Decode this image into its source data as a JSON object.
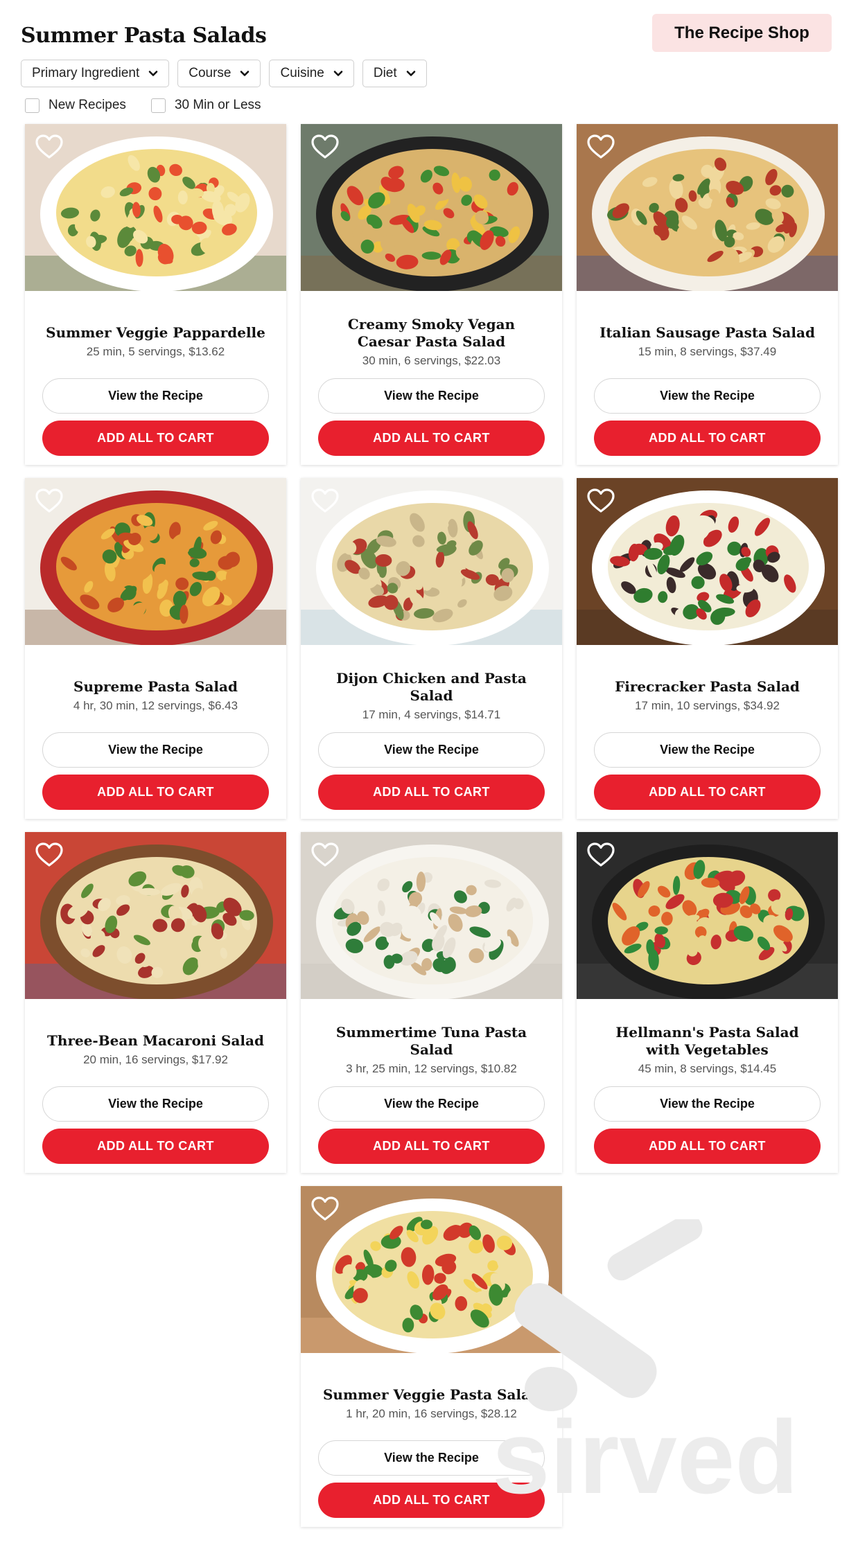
{
  "header": {
    "title": "Summer Pasta Salads",
    "shop_label": "The Recipe Shop"
  },
  "filters": [
    {
      "label": "Primary Ingredient"
    },
    {
      "label": "Course"
    },
    {
      "label": "Cuisine"
    },
    {
      "label": "Diet"
    }
  ],
  "checkboxes": [
    {
      "label": "New Recipes",
      "checked": false
    },
    {
      "label": "30 Min or Less",
      "checked": false
    }
  ],
  "buttons": {
    "view_label": "View the Recipe",
    "cart_label": "ADD ALL TO CART"
  },
  "colors": {
    "accent": "#e8202e",
    "badge_bg": "#fbe3e3"
  },
  "watermark_text": "sirved",
  "recipes": [
    {
      "title": "Summer Veggie Pappardelle",
      "meta": "25 min, 5 servings, $13.62",
      "favorited": false
    },
    {
      "title": "Creamy Smoky Vegan Caesar Pasta Salad",
      "meta": "30 min, 6 servings, $22.03",
      "favorited": false
    },
    {
      "title": "Italian Sausage Pasta Salad",
      "meta": "15 min, 8 servings, $37.49",
      "favorited": false
    },
    {
      "title": "Supreme Pasta Salad",
      "meta": "4 hr, 30 min, 12 servings, $6.43",
      "favorited": false
    },
    {
      "title": "Dijon Chicken and Pasta Salad",
      "meta": "17 min, 4 servings, $14.71",
      "favorited": false
    },
    {
      "title": "Firecracker Pasta Salad",
      "meta": "17 min, 10 servings, $34.92",
      "favorited": false
    },
    {
      "title": "Three-Bean Macaroni Salad",
      "meta": "20 min, 16 servings, $17.92",
      "favorited": false
    },
    {
      "title": "Summertime Tuna Pasta Salad",
      "meta": "3 hr, 25 min, 12 servings, $10.82",
      "favorited": false
    },
    {
      "title": "Hellmann's Pasta Salad with Vegetables",
      "meta": "45 min, 8 servings, $14.45",
      "favorited": false
    },
    {
      "title": "Summer Veggie Pasta Salad",
      "meta": "1 hr, 20 min, 16 servings, $28.12",
      "favorited": false
    }
  ]
}
